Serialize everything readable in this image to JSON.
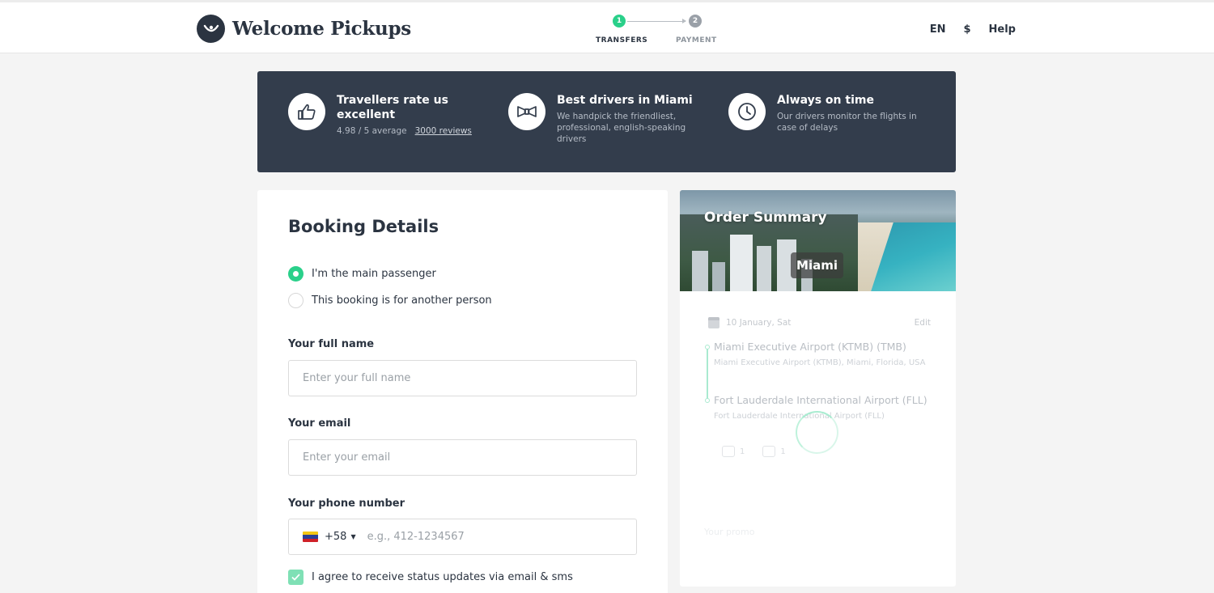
{
  "header": {
    "logo_text": "Welcome Pickups",
    "steps": [
      {
        "number": "1",
        "label": "TRANSFERS",
        "active": true
      },
      {
        "number": "2",
        "label": "PAYMENT",
        "active": false
      }
    ],
    "nav": {
      "language": "EN",
      "currency": "$",
      "help": "Help"
    }
  },
  "benefits": [
    {
      "icon": "thumbs-up-icon",
      "title": "Travellers rate us excellent",
      "rating": "4.98 / 5 average",
      "reviews_link": "3000 reviews"
    },
    {
      "icon": "bow-tie-icon",
      "title": "Best drivers in Miami",
      "subtitle": "We handpick the friendliest, professional, english-speaking drivers"
    },
    {
      "icon": "clock-icon",
      "title": "Always on time",
      "subtitle": "Our drivers monitor the flights in case of delays"
    }
  ],
  "booking": {
    "title": "Booking Details",
    "passenger_options": [
      {
        "label": "I'm the main passenger",
        "selected": true
      },
      {
        "label": "This booking is for another person",
        "selected": false
      }
    ],
    "full_name": {
      "label": "Your full name",
      "placeholder": "Enter your full name",
      "value": ""
    },
    "email": {
      "label": "Your email",
      "placeholder": "Enter your email",
      "value": ""
    },
    "phone": {
      "label": "Your phone number",
      "country_code": "+58",
      "placeholder": "e.g., 412-1234567",
      "value": ""
    },
    "consent": {
      "label": "I agree to receive status updates via email & sms",
      "checked": true
    }
  },
  "summary": {
    "title": "Order Summary",
    "city": "Miami",
    "date": "10 January, Sat",
    "edit_label": "Edit",
    "from": {
      "name": "Miami Executive Airport (KTMB) (TMB)",
      "address": "Miami Executive Airport (KTMB), Miami, Florida, USA"
    },
    "to": {
      "name": "Fort Lauderdale International Airport (FLL)",
      "address": "Fort Lauderdale International Airport (FLL)"
    },
    "passengers": "1",
    "luggage": "1",
    "promo_label": "Your promo"
  },
  "colors": {
    "accent": "#2ad08a",
    "dark": "#333d4c",
    "text": "#2b3441"
  }
}
